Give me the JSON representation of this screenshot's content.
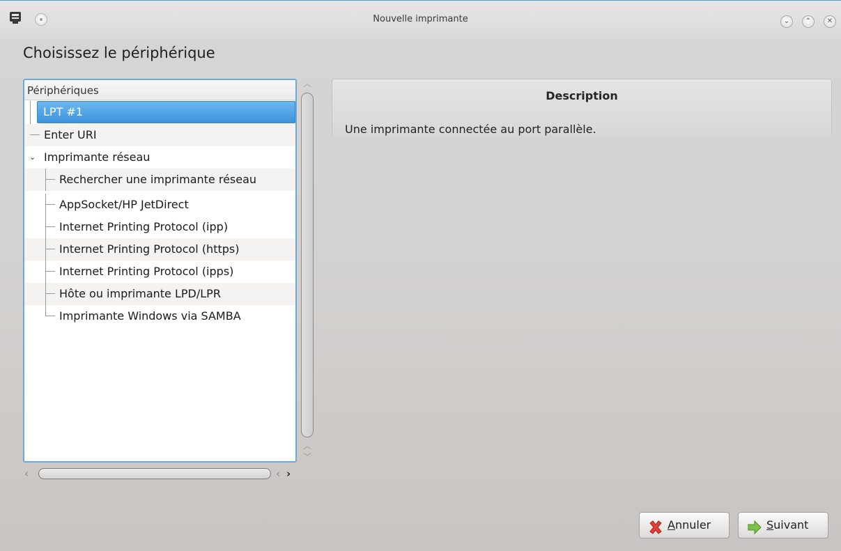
{
  "window": {
    "title": "Nouvelle imprimante",
    "controls": [
      "minimize-icon",
      "maximize-icon",
      "close-icon"
    ]
  },
  "page": {
    "heading": "Choisissez le périphérique"
  },
  "device_list": {
    "header": "Périphériques",
    "items": [
      {
        "label": "LPT #1",
        "level": 0,
        "selected": true
      },
      {
        "label": "Enter URI",
        "level": 0
      },
      {
        "label": "Imprimante réseau",
        "level": 0,
        "expanded": true
      },
      {
        "label": "Rechercher une imprimante réseau",
        "level": 1
      },
      {
        "label": "AppSocket/HP JetDirect",
        "level": 1
      },
      {
        "label": "Internet Printing Protocol (ipp)",
        "level": 1
      },
      {
        "label": "Internet Printing Protocol (https)",
        "level": 1
      },
      {
        "label": "Internet Printing Protocol (ipps)",
        "level": 1
      },
      {
        "label": "Hôte ou imprimante LPD/LPR",
        "level": 1
      },
      {
        "label": "Imprimante Windows via SAMBA",
        "level": 1
      }
    ]
  },
  "description": {
    "title": "Description",
    "text": "Une imprimante connectée au port parallèle."
  },
  "buttons": {
    "cancel": {
      "label_pre": "",
      "mnemonic": "A",
      "label_post": "nnuler"
    },
    "next": {
      "label_pre": "",
      "mnemonic": "S",
      "label_post": "uivant"
    }
  },
  "colors": {
    "selection": "#3b93dc",
    "focus_border": "#6aa9d8"
  }
}
